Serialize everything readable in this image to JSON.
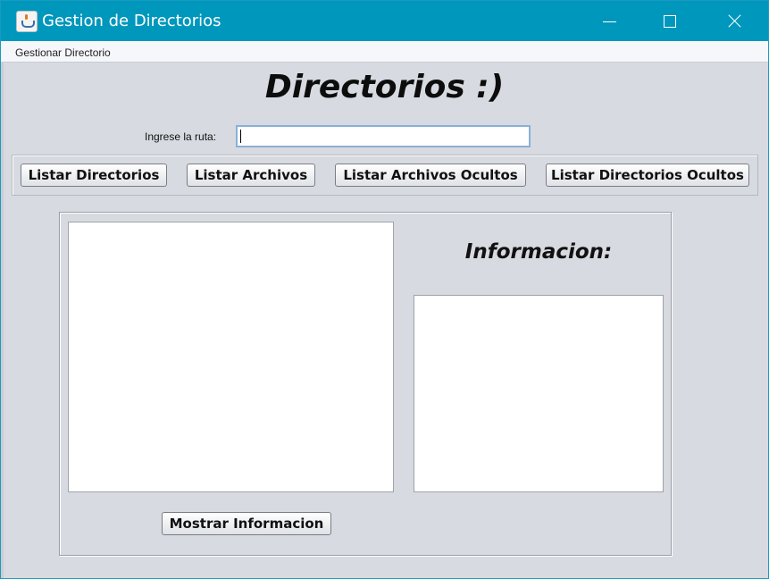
{
  "window": {
    "title": "Gestion de Directorios",
    "icon": "java-cup-icon"
  },
  "menubar": {
    "items": [
      {
        "label": "Gestionar Directorio"
      }
    ]
  },
  "header": {
    "title": "Directorios :)"
  },
  "path_field": {
    "label": "Ingrese la ruta:",
    "value": ""
  },
  "toolbar": {
    "list_directories": "Listar Directorios",
    "list_files": "Listar Archivos",
    "list_hidden_files": "Listar Archivos Ocultos",
    "list_hidden_directories": "Listar Directorios Ocultos"
  },
  "results": {
    "items": []
  },
  "info": {
    "title": "Informacion:",
    "text": "",
    "show_button": "Mostrar Informacion"
  },
  "colors": {
    "titlebar": "#0097bd",
    "window_bg": "#d7dae0"
  }
}
